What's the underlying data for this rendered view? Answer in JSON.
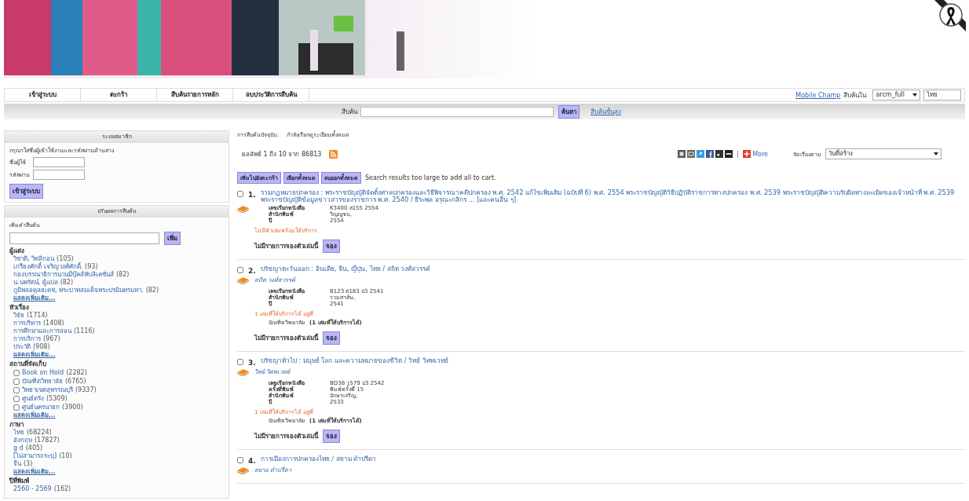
{
  "nav": {
    "tabs": [
      {
        "label": "เข้าสู่ระบบ",
        "selected": false
      },
      {
        "label": "ตะกร้า",
        "selected": false
      },
      {
        "label": "สืบค้นรายการหลัก",
        "selected": false
      },
      {
        "label": "ลบประวัติการสืบค้น",
        "selected": false
      }
    ],
    "mobile_link": "Mobile Champ",
    "scope_label": "สืบค้นใน",
    "scope": "arcm_full",
    "language": "ไทย"
  },
  "search": {
    "label": "สืบค้น",
    "button": "ค้นหา",
    "advanced_link": "สืบค้นขั้นสูง"
  },
  "login": {
    "title": "ระบบสมาชิก",
    "hint": "กรุณาใส่ชื่อผู้เข้าใช้งานและรหัสผ่านด้านล่าง",
    "fields": [
      {
        "label": "ชื่อผู้ใช้"
      },
      {
        "label": "รหัสผ่าน"
      }
    ],
    "button": "เข้าสู่ระบบ"
  },
  "refine": {
    "title": "ปรับผลการสืบค้น",
    "filter_label": "เพิ่มคำสืบค้น",
    "button": "เพิ่ม",
    "facets": [
      {
        "title": "ผู้แต่ง",
        "kind": "links",
        "items": [
          {
            "label": "วิชาติ, วิทลิกอน",
            "count": "(105)"
          },
          {
            "label": "เกรียงศักดิ์ เจริญวงศ์ศักดิ์.",
            "count": "(93)"
          },
          {
            "label": "กองบรรณาธิการนานมีบุ๊คส์พับลิเคชั่นส์",
            "count": "(82)"
          },
          {
            "label": "น.นพรัตน์, ผู้แปล",
            "count": "(82)"
          },
          {
            "label": "ภูมิพลอดุลยเดช, พระบาทสมเด็จพระปรมินทรมหา.",
            "count": "(82)"
          }
        ],
        "more": "แสดงเพิ่มเติม..."
      },
      {
        "title": "หัวเรื่อง",
        "kind": "links",
        "items": [
          {
            "label": "วิจัย",
            "count": "(1714)"
          },
          {
            "label": "การบริหาร",
            "count": "(1408)"
          },
          {
            "label": "การศึกษาและการสอน",
            "count": "(1116)"
          },
          {
            "label": "การบริการ",
            "count": "(967)"
          },
          {
            "label": "ประวัติ",
            "count": "(908)"
          }
        ],
        "more": "แสดงเพิ่มเติม..."
      },
      {
        "title": "สถานที่จัดเก็บ",
        "kind": "checkboxes",
        "items": [
          {
            "label": "Book on Hold",
            "count": "(2282)",
            "checked": false
          },
          {
            "label": "บัณฑิตวิทยาลัย",
            "count": "(6765)",
            "checked": false
          },
          {
            "label": "วิทยาเขตสุพรรณบุรี",
            "count": "(9337)",
            "checked": false
          },
          {
            "label": "ศูนย์ตรัง",
            "count": "(5309)",
            "checked": false
          },
          {
            "label": "ศูนย์นครนายก",
            "count": "(3900)",
            "checked": false
          }
        ],
        "more": "แสดงเพิ่มเติม..."
      },
      {
        "title": "ภาษา",
        "kind": "links",
        "items": [
          {
            "label": "ไทย",
            "count": "(68224)"
          },
          {
            "label": "อังกฤษ",
            "count": "(17827)"
          },
          {
            "label": "g d",
            "count": "(405)"
          },
          {
            "label": "[ไม่สามารถระบุ]",
            "count": "(10)"
          },
          {
            "label": "จีน",
            "count": "(3)"
          }
        ],
        "more": "แสดงเพิ่มเติม..."
      },
      {
        "title": "ปีที่พิมพ์",
        "kind": "links",
        "items": [
          {
            "label": "2560 - 2569",
            "count": "(162)"
          }
        ]
      }
    ]
  },
  "results": {
    "query_label": "การสืบค้นปัจจุบัน:",
    "query": "กำลังเรียกดูระเบียนทั้งหมด",
    "summary": "ผลลัพธ์ 1 ถึง 10 จาก 86813",
    "more": "More",
    "sort_label": "จัดเรียงตาม",
    "sort": "วันที่สร้าง",
    "buttons": [
      "เพิ่มไปยังตะกร้า",
      "เลือกทั้งหมด",
      "ลบออกทั้งหมด"
    ],
    "note": "Search results too large to add all to cart.",
    "records": [
      {
        "number": "1.",
        "checked": false,
        "title": "รวมกฎหมายปกครอง : พระราชบัญญัติจัดตั้งศาลปกครองและวิธีพิจารณาคดีปกครอง พ.ศ. 2542 แก้ไขเพิ่มเติม (ฉบับที่ 6) พ.ศ. 2554 พระราชบัญญัติวิธีปฏิบัติราชการทางปกครอง พ.ศ. 2539 พระราชบัญญัติความรับผิดทางละเมิดของเจ้าหน้าที่ พ.ศ. 2539 พระราชบัญญัติข้อมูลข่าวสารของราชการ พ.ศ. 2540 / ธีระพล อรุณะกสิกร ... [และคนอื่น ๆ]",
        "fields": [
          {
            "label": "เลขเรียกหนังสือ",
            "value": "K3400 ส155 2554"
          },
          {
            "label": "สำนักพิมพ์",
            "value": "วิญญูชน,"
          },
          {
            "label": "ปี",
            "value": "2554"
          }
        ],
        "status": "ไม่มีตัวเล่มพร้อมให้บริการ",
        "hold_text": "ไม่มีรายการจองตัวเล่มนี้",
        "hold_button": "จอง"
      },
      {
        "number": "2.",
        "checked": false,
        "title": "ปรัชญาตะวันออก : อินเดีย, จีน, ญี่ปุ่น, ไทย / สถิต วงศ์สวรรค์",
        "author": "สถิต วงศ์สวรรค์",
        "fields": [
          {
            "label": "เลขเรียกหนังสือ",
            "value": "B123 ส183 ป3 2541"
          },
          {
            "label": "สำนักพิมพ์",
            "value": "รวมสาส์น,"
          },
          {
            "label": "ปี",
            "value": "2541"
          }
        ],
        "status": "1 เล่มที่ให้บริการได้ อยู่ที่",
        "location": "บัณฑิตวิทยาลัย",
        "location_count": "(1 เล่มที่ให้บริการได้)",
        "hold_text": "ไม่มีรายการจองตัวเล่มนี้",
        "hold_button": "จอง"
      },
      {
        "number": "3.",
        "checked": false,
        "title": "ปรัชญาทั่วไป : มนุษย์ โลก และความหมายของชีวิต / วิทย์ วิศทเวทย์",
        "author": "วิทย์ วิศทเวทย์",
        "fields": [
          {
            "label": "เลขเรียกหนังสือ",
            "value": "BD38 ว579 ป3 2542"
          },
          {
            "label": "ครั้งที่พิมพ์",
            "value": "พิมพ์ครั้งที่ 15"
          },
          {
            "label": "สำนักพิมพ์",
            "value": "อักษรเจริญ,"
          },
          {
            "label": "ปี",
            "value": "2533"
          }
        ],
        "status": "1 เล่มที่ให้บริการได้ อยู่ที่",
        "location": "บัณฑิตวิทยาลัย",
        "location_count": "(1 เล่มที่ให้บริการได้)",
        "hold_text": "ไม่มีรายการจองตัวเล่มนี้",
        "hold_button": "จอง"
      },
      {
        "number": "4.",
        "checked": false,
        "title": "การเมืองการปกครองไทย / สยาม ดำปรีดา",
        "author": "สยาม ดำปรีดา"
      }
    ]
  }
}
